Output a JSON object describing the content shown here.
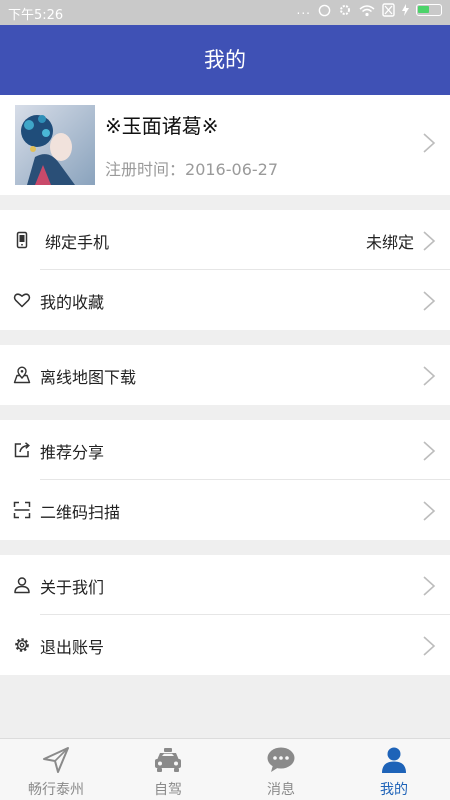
{
  "status_bar": {
    "time": "下午5:26",
    "dots": "..."
  },
  "header": {
    "title": "我的"
  },
  "profile": {
    "nickname": "※玉面诸葛※",
    "register_label": "注册时间：",
    "register_date": "2016-06-27"
  },
  "menu": {
    "bind_phone": {
      "label": "绑定手机",
      "value": "未绑定",
      "icon": "phone-icon"
    },
    "favorites": {
      "label": "我的收藏",
      "icon": "heart-icon"
    },
    "offline_map": {
      "label": "离线地图下载",
      "icon": "map-pin-icon"
    },
    "share": {
      "label": "推荐分享",
      "icon": "share-icon"
    },
    "scan": {
      "label": "二维码扫描",
      "icon": "scan-icon"
    },
    "about": {
      "label": "关于我们",
      "icon": "person-icon"
    },
    "logout": {
      "label": "退出账号",
      "icon": "gear-icon"
    }
  },
  "tabs": [
    {
      "label": "畅行泰州",
      "icon": "navigate-icon",
      "active": false
    },
    {
      "label": "自驾",
      "icon": "taxi-icon",
      "active": false
    },
    {
      "label": "消息",
      "icon": "message-icon",
      "active": false
    },
    {
      "label": "我的",
      "icon": "user-icon",
      "active": true
    }
  ],
  "colors": {
    "header": "#3f51b5",
    "active_tab": "#1e63b8",
    "inactive_tab": "#8a8a8a"
  }
}
